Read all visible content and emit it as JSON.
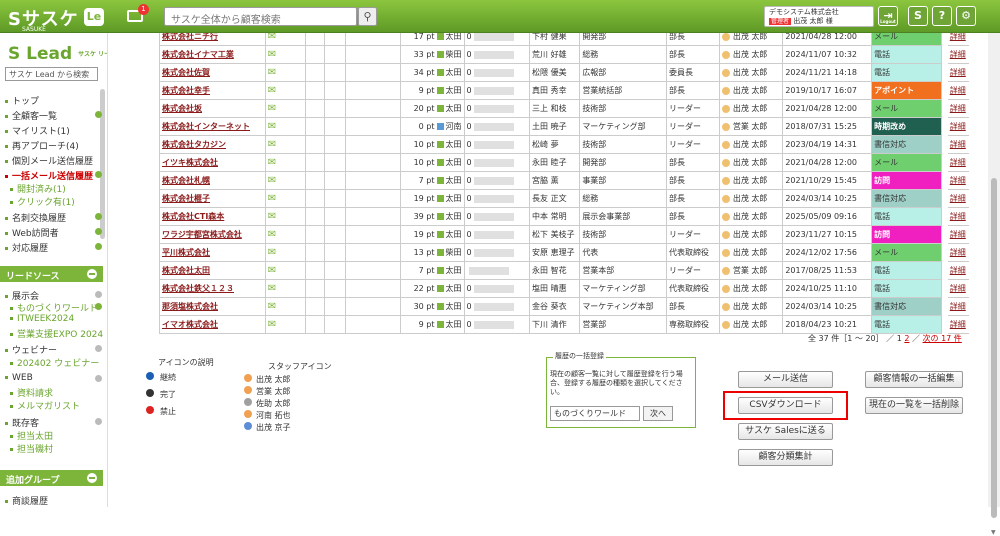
{
  "topbar": {
    "logo": "Sサスケ",
    "logo_sub": "SASUKE",
    "le": "Le",
    "mail_count": "1",
    "search_placeholder": "サスケ全体から顧客検索",
    "company": "デモシステム株式会社",
    "role": "管理者",
    "user": "出茂 太郎 様",
    "logout": "Logout"
  },
  "sidebar": {
    "logo": "Lead",
    "logo_sub": "サスケ リード",
    "search": "サスケ Lead から検索",
    "items": [
      "トップ",
      "全顧客一覧",
      "マイリスト(1)",
      "再アプローチ(4)",
      "個別メール送信履歴",
      "一括メール送信履歴",
      "開封済み(1)",
      "クリック有(1)",
      "名刺交換履歴",
      "Web訪問者",
      "対応履歴"
    ],
    "lead_source": "リードソース",
    "exhibition": "展示会",
    "exh_items": [
      "ものづくりワールド",
      "ITWEEK2024",
      "営業支援EXPO 2024"
    ],
    "webinar": "ウェビナー",
    "web_items": [
      "202402 ウェビナー"
    ],
    "web": "WEB",
    "web_sub": [
      "資料請求",
      "メルマガリスト"
    ],
    "existing": "既存客",
    "exist_items": [
      "担当太田",
      "担当磯村"
    ],
    "addgroup": "追加グループ",
    "add_items": [
      "商談履歴"
    ]
  },
  "rows": [
    {
      "name": "株式会社ニチ行",
      "pt": "17 pt",
      "own": "太田",
      "ph": "0",
      "pr": "下村 健果",
      "dp": "開発部",
      "ti": "部長",
      "st": "出茂 太郎",
      "dt": "2021/04/28 12:00",
      "ac": "メール",
      "acc": "#6fcf6f"
    },
    {
      "name": "株式会社イナマ工業",
      "pt": "33 pt",
      "own": "柴田",
      "ph": "0",
      "pr": "荒川 好雄",
      "dp": "総務",
      "ti": "部長",
      "st": "出茂 太郎",
      "dt": "2024/11/07 10:32",
      "ac": "電話",
      "acc": "#b8f0e8"
    },
    {
      "name": "株式会社佐賀",
      "pt": "34 pt",
      "own": "太田",
      "ph": "0",
      "pr": "松隈 優美",
      "dp": "広報部",
      "ti": "委員長",
      "st": "出茂 太郎",
      "dt": "2024/11/21 14:18",
      "ac": "電話",
      "acc": "#b8f0e8"
    },
    {
      "name": "株式会社幸手",
      "pt": "9 pt",
      "own": "太田",
      "ph": "0",
      "pr": "真田 秀幸",
      "dp": "営業統括部",
      "ti": "部長",
      "st": "出茂 太郎",
      "dt": "2019/10/17 16:07",
      "ac": "アポイント",
      "acc": "#f07020"
    },
    {
      "name": "株式会社坂",
      "pt": "20 pt",
      "own": "太田",
      "ph": "0",
      "pr": "三上 和枝",
      "dp": "技術部",
      "ti": "リーダー",
      "st": "出茂 太郎",
      "dt": "2021/04/28 12:00",
      "ac": "メール",
      "acc": "#6fcf6f"
    },
    {
      "name": "株式会社インターネット",
      "pt": "0 pt",
      "own": "河南",
      "ph": "0",
      "pr": "土田 暁子",
      "dp": "マーケティング部",
      "ti": "リーダー",
      "st": "営業 太郎",
      "dt": "2018/07/31 15:25",
      "ac": "時期改め",
      "acc": "#1f6050"
    },
    {
      "name": "株式会社タカジン",
      "pt": "10 pt",
      "own": "太田",
      "ph": "0",
      "pr": "松崎 夢",
      "dp": "技術部",
      "ti": "リーダー",
      "st": "出茂 太郎",
      "dt": "2023/04/19 14:31",
      "ac": "書信対応",
      "acc": "#9fd0c8"
    },
    {
      "name": "イツキ株式会社",
      "pt": "10 pt",
      "own": "太田",
      "ph": "0",
      "pr": "永田 睦子",
      "dp": "開発部",
      "ti": "部長",
      "st": "出茂 太郎",
      "dt": "2021/04/28 12:00",
      "ac": "メール",
      "acc": "#6fcf6f"
    },
    {
      "name": "株式会社札幌",
      "pt": "7 pt",
      "own": "太田",
      "ph": "0",
      "pr": "宮脇 薫",
      "dp": "事業部",
      "ti": "部長",
      "st": "出茂 太郎",
      "dt": "2021/10/29 15:45",
      "ac": "訪問",
      "acc": "#f020c0"
    },
    {
      "name": "株式会社榧子",
      "pt": "19 pt",
      "own": "太田",
      "ph": "0",
      "pr": "長友 正文",
      "dp": "総務",
      "ti": "部長",
      "st": "出茂 太郎",
      "dt": "2024/03/14 10:25",
      "ac": "書信対応",
      "acc": "#9fd0c8"
    },
    {
      "name": "株式会社CTI森本",
      "pt": "39 pt",
      "own": "太田",
      "ph": "0",
      "pr": "中本 常明",
      "dp": "展示会事業部",
      "ti": "部長",
      "st": "出茂 太郎",
      "dt": "2025/05/09 09:16",
      "ac": "電話",
      "acc": "#b8f0e8"
    },
    {
      "name": "ワラジ宇都宮株式会社",
      "pt": "19 pt",
      "own": "太田",
      "ph": "0",
      "pr": "松下 美枝子",
      "dp": "技術部",
      "ti": "リーダー",
      "st": "出茂 太郎",
      "dt": "2023/11/27 10:15",
      "ac": "訪問",
      "acc": "#f020c0"
    },
    {
      "name": "平川株式会社",
      "pt": "13 pt",
      "own": "柴田",
      "ph": "0",
      "pr": "安原 恵理子",
      "dp": "代表",
      "ti": "代表取締役",
      "st": "出茂 太郎",
      "dt": "2024/12/02 17:56",
      "ac": "メール",
      "acc": "#6fcf6f"
    },
    {
      "name": "株式会社太田",
      "pt": "7 pt",
      "own": "太田",
      "ph": "",
      "pr": "永田 智花",
      "dp": "営業本部",
      "ti": "リーダー",
      "st": "営業 太郎",
      "dt": "2017/08/25 11:53",
      "ac": "電話",
      "acc": "#b8f0e8"
    },
    {
      "name": "株式会社鉄父１２３",
      "pt": "22 pt",
      "own": "太田",
      "ph": "0",
      "pr": "塩田 晴惠",
      "dp": "マーケティング部",
      "ti": "代表取締役",
      "st": "出茂 太郎",
      "dt": "2024/10/25 11:10",
      "ac": "電話",
      "acc": "#b8f0e8"
    },
    {
      "name": "那須塩株式会社",
      "pt": "30 pt",
      "own": "太田",
      "ph": "0",
      "pr": "金谷 葵衣",
      "dp": "マーケティング本部",
      "ti": "部長",
      "st": "出茂 太郎",
      "dt": "2024/03/14 10:25",
      "ac": "書信対応",
      "acc": "#9fd0c8"
    },
    {
      "name": "イマオ株式会社",
      "pt": "9 pt",
      "own": "太田",
      "ph": "0",
      "pr": "下川 清作",
      "dp": "営業部",
      "ti": "専務取締役",
      "st": "出茂 太郎",
      "dt": "2018/04/23 10:21",
      "ac": "電話",
      "acc": "#b8f0e8"
    }
  ],
  "detail": "詳細",
  "pager": {
    "total": "全 37 件［1 ～ 20］",
    "slash": "／",
    "p1": "1",
    "p2": "2",
    "next": "次の 17 件"
  },
  "legend": {
    "title": "アイコンの説明",
    "items": [
      "継続",
      "完了",
      "禁止"
    ],
    "staff_title": "スタッフアイコン",
    "staff": [
      "出茂 太郎",
      "営業 太郎",
      "佐助 太郎",
      "河南 拓也",
      "出茂 京子"
    ]
  },
  "bulk": {
    "title": "履歴の一括登録",
    "desc": "現在の顧客一覧に対して履歴登録を行う場合、登録する履歴の種類を選択してください。",
    "select": "ものづくりワールド",
    "next": "次へ"
  },
  "buttons": {
    "mail": "メール送信",
    "csv": "CSVダウンロード",
    "sales": "サスケ Salesに送る",
    "stats": "顧客分類集計",
    "bulk_edit": "顧客情報の一括編集",
    "bulk_delete": "現在の一覧を一括削除"
  }
}
